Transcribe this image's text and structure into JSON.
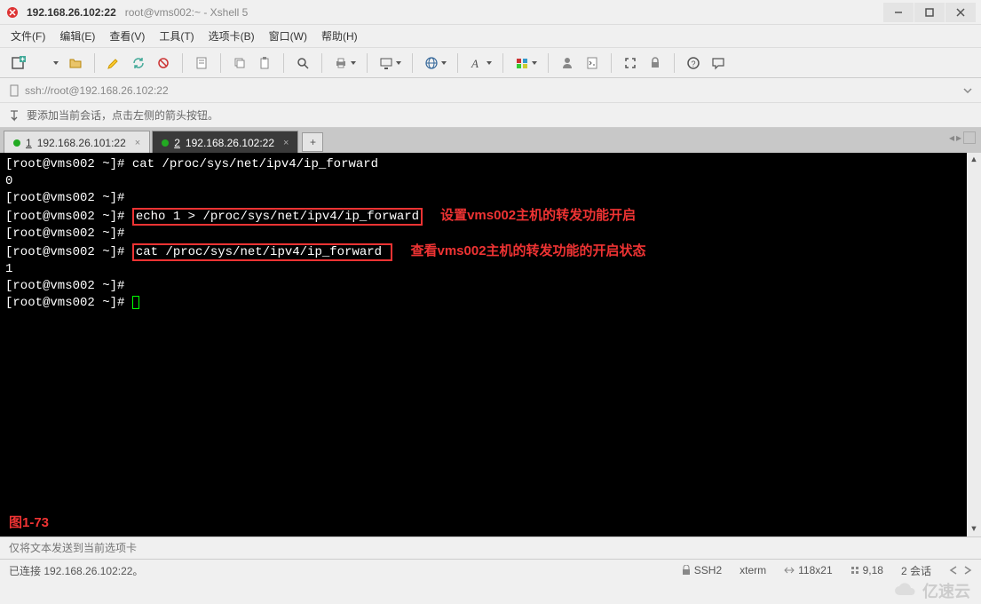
{
  "window": {
    "title_main": "192.168.26.102:22",
    "title_sub": "root@vms002:~ - Xshell 5"
  },
  "menu": {
    "file": "文件(F)",
    "edit": "编辑(E)",
    "view": "查看(V)",
    "tools": "工具(T)",
    "tabs": "选项卡(B)",
    "window": "窗口(W)",
    "help": "帮助(H)"
  },
  "addressbar": {
    "url": "ssh://root@192.168.26.102:22"
  },
  "tipbar": {
    "text": "要添加当前会话，点击左侧的箭头按钮。"
  },
  "tabs": [
    {
      "num": "1",
      "label": "192.168.26.101:22",
      "active": false
    },
    {
      "num": "2",
      "label": "192.168.26.102:22",
      "active": true
    }
  ],
  "tab_add": "+",
  "terminal": {
    "lines": [
      {
        "prompt": "[root@vms002 ~]# ",
        "cmd": "cat /proc/sys/net/ipv4/ip_forward"
      },
      {
        "plain": "0"
      },
      {
        "prompt": "[root@vms002 ~]# ",
        "cmd": ""
      },
      {
        "prompt": "[root@vms002 ~]# ",
        "hl": "echo 1 > /proc/sys/net/ipv4/ip_forward",
        "anno": "设置vms002主机的转发功能开启"
      },
      {
        "prompt": "[root@vms002 ~]# ",
        "cmd": ""
      },
      {
        "prompt": "[root@vms002 ~]# ",
        "hl": "cat /proc/sys/net/ipv4/ip_forward ",
        "anno": "查看vms002主机的转发功能的开启状态"
      },
      {
        "plain": "1"
      },
      {
        "prompt": "[root@vms002 ~]# ",
        "cmd": ""
      },
      {
        "prompt": "[root@vms002 ~]# ",
        "cursor": true
      }
    ],
    "figure_label": "图1-73"
  },
  "inputbar": {
    "placeholder": "仅将文本发送到当前选项卡"
  },
  "statusbar": {
    "connection": "已连接 192.168.26.102:22。",
    "ssh": "SSH2",
    "term": "xterm",
    "size": "118x21",
    "pos": "9,18",
    "sessions": "2 会话"
  },
  "watermark": "亿速云"
}
